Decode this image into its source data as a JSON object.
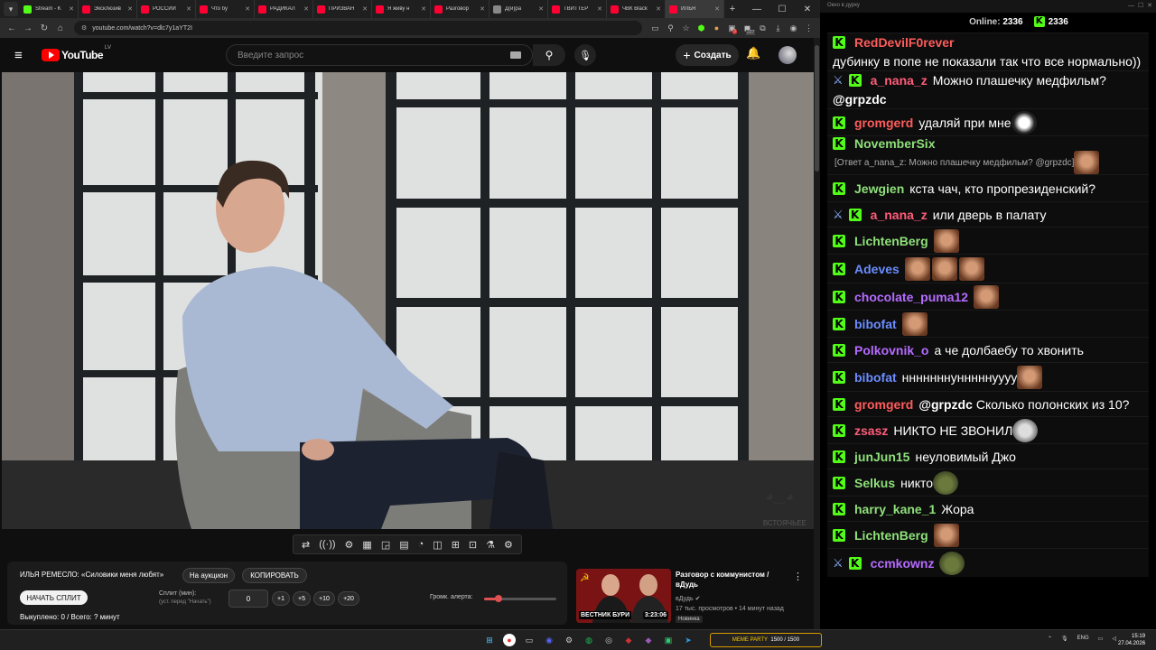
{
  "browser": {
    "tabs": [
      {
        "label": "Stream - K",
        "fav": "#53fc18",
        "active": false
      },
      {
        "label": "Эксклюзив",
        "fav": "#ff0033",
        "active": false
      },
      {
        "label": "РОССИЙ",
        "fav": "#ff0033",
        "active": false
      },
      {
        "label": "Что бу",
        "fav": "#ff0033",
        "active": false
      },
      {
        "label": "РАДИКАЛ",
        "fav": "#ff0033",
        "active": false
      },
      {
        "label": "ПРИЗВАН",
        "fav": "#ff0033",
        "active": false
      },
      {
        "label": "Я живу н",
        "fav": "#ff0033",
        "active": false
      },
      {
        "label": "Разговор",
        "fav": "#ff0033",
        "active": false
      },
      {
        "label": "Д(и)ра",
        "fav": "#888888",
        "active": false
      },
      {
        "label": "ТВИТТЕР",
        "fav": "#ff0033",
        "active": false
      },
      {
        "label": "ЧВК Black",
        "fav": "#ff0033",
        "active": false
      },
      {
        "label": "ИЛЬЯ",
        "fav": "#ff0033",
        "active": true
      }
    ],
    "url": "youtube.com/watch?v=dlc7y1aYT2I",
    "badge_red": "3",
    "badge_count": "227"
  },
  "youtube": {
    "logo_text": "YouTube",
    "logo_region": "LV",
    "search_placeholder": "Введите запрос",
    "create_label": "Создать",
    "video_watermark": "ВСТОЯЧЬЕЕ"
  },
  "extension_panel": {
    "title": "ИЛЬЯ РЕМЕСЛО: «Силовики меня любят»",
    "auction_label": "На аукцион",
    "copy_label": "КОПИРОВАТЬ",
    "start_split_label": "НАЧАТЬ СПЛИТ",
    "split_label": "Сплит (мин):",
    "split_hint": "(уст. перед \"Начать\")",
    "split_value": "0",
    "increments": [
      "+1",
      "+5",
      "+10",
      "+20"
    ],
    "alert_volume_label": "Громк. алерта:",
    "alert_volume": 0.2,
    "stats": "Выкуплено: 0 / Всего: ? минут"
  },
  "recommended": {
    "title": "Разговор с коммунистом / вДудь",
    "channel": "вДудь",
    "meta": "17 тыс. просмотров • 14 минут назад",
    "badge": "Новинка",
    "duration": "3:23:06",
    "thumb_text": "ВЕСТНИК БУРИ"
  },
  "chat": {
    "window_title": "Окно в дурку",
    "online_label": "Online:",
    "online_count": "2336",
    "viewer_count": "2336",
    "messages": [
      {
        "user": "RedDevilF0rever",
        "color": "#ff5c5c",
        "text": "дубинку в попе не показали так что все нормально))",
        "pin": false
      },
      {
        "user": "a_nana_z",
        "color": "#ff5c7a",
        "text": "Можно плашечку медфильм?",
        "mention": "@grpzdc",
        "pin": true
      },
      {
        "user": "gromgerd",
        "color": "#ff5c5c",
        "text": "удаляй при мне",
        "emote": "joker"
      },
      {
        "user": "NovemberSix",
        "color": "#8fe07a",
        "reply": "[Ответ a_nana_z: Можно плашечку медфильм? @grpzdc]",
        "emote": "face"
      },
      {
        "user": "Jewgien",
        "color": "#8fe07a",
        "text": "кста чач, кто пропрезиденский?"
      },
      {
        "user": "a_nana_z",
        "color": "#ff5c7a",
        "text": "или дверь в палату",
        "pin": true
      },
      {
        "user": "LichtenBerg",
        "color": "#8fe07a",
        "emote": "face"
      },
      {
        "user": "Adeves",
        "color": "#6b8cff",
        "emotes": 3
      },
      {
        "user": "chocolate_puma12",
        "color": "#b56bff",
        "emote": "face"
      },
      {
        "user": "bibofat",
        "color": "#6b8cff",
        "emote": "face"
      },
      {
        "user": "Polkovnik_o",
        "color": "#b56bff",
        "text": "а че долбаебу то хвонить"
      },
      {
        "user": "bibofat",
        "color": "#6b8cff",
        "text": "нннннннунннннуууу",
        "emote": "face"
      },
      {
        "user": "gromgerd",
        "color": "#ff5c5c",
        "mention": "@grpzdc",
        "text": "Сколько полонских из 10?"
      },
      {
        "user": "zsasz",
        "color": "#ff5c7a",
        "text": "НИКТО НЕ ЗВОНИЛ",
        "emote": "cat"
      },
      {
        "user": "junJun15",
        "color": "#8fe07a",
        "text": "неуловимый Джо"
      },
      {
        "user": "Selkus",
        "color": "#8fe07a",
        "text": "никто",
        "emote": "frog"
      },
      {
        "user": "harry_kane_1",
        "color": "#8fe07a",
        "text": "Жора"
      },
      {
        "user": "LichtenBerg",
        "color": "#8fe07a",
        "emote": "face"
      },
      {
        "user": "ccmkownz",
        "color": "#b56bff",
        "emote": "frog",
        "pin": true
      }
    ]
  },
  "taskbar": {
    "meme_label": "MEME PARTY",
    "meme_progress": "1500 / 1500",
    "lang": "ENG",
    "time": "15:19",
    "date": "27.04.2026"
  }
}
